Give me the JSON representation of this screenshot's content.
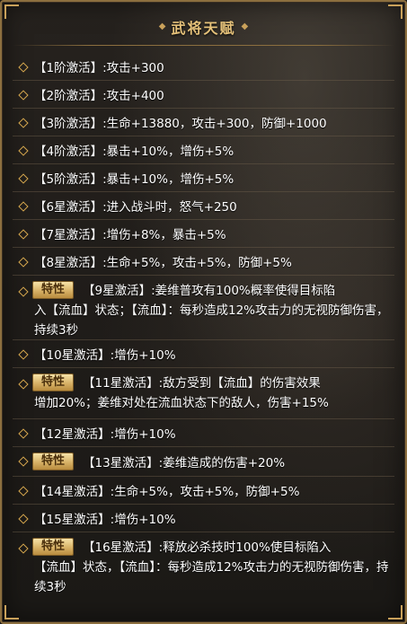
{
  "panel": {
    "title": "武将天赋",
    "badge_label": "特性",
    "items": [
      {
        "text": "【1阶激活】:攻击+300",
        "special": false
      },
      {
        "text": "【2阶激活】:攻击+400",
        "special": false
      },
      {
        "text": "【3阶激活】:生命+13880，攻击+300，防御+1000",
        "special": false
      },
      {
        "text": "【4阶激活】:暴击+10%，增伤+5%",
        "special": false
      },
      {
        "text": "【5阶激活】:暴击+10%，增伤+5%",
        "special": false
      },
      {
        "text": "【6星激活】:进入战斗时，怒气+250",
        "special": false
      },
      {
        "text": "【7星激活】:增伤+8%，暴击+5%",
        "special": false
      },
      {
        "text": "【8星激活】:生命+5%，攻击+5%，防御+5%",
        "special": false
      },
      {
        "text_line1": "【9星激活】:姜维普攻有100%概率使得目标陷",
        "text_rest": "入【流血】状态；【流血】：每秒造成12%攻击力的无视防御伤害，持续3秒",
        "special": true
      },
      {
        "text": "【10星激活】:增伤+10%",
        "special": false
      },
      {
        "text_line1": "【11星激活】:敌方受到【流血】的伤害效果",
        "text_rest": "增加20%；姜维对处在流血状态下的敌人，伤害+15%",
        "special": true
      },
      {
        "text": "【12星激活】:增伤+10%",
        "special": false
      },
      {
        "text_line1": "【13星激活】:姜维造成的伤害+20%",
        "text_rest": "",
        "special": true
      },
      {
        "text": "【14星激活】:生命+5%，攻击+5%，防御+5%",
        "special": false
      },
      {
        "text": "【15星激活】:增伤+10%",
        "special": false
      },
      {
        "text_line1": "【16星激活】:释放必杀技时100%使目标陷入",
        "text_rest": "【流血】状态，【流血】：每秒造成12%攻击力的无视防御伤害，持续3秒",
        "special": true
      }
    ]
  }
}
